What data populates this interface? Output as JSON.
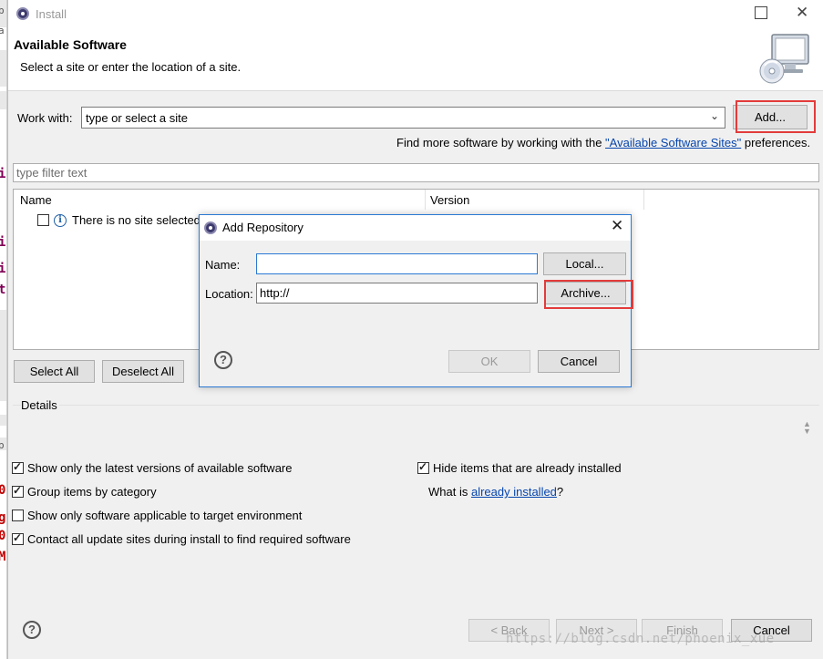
{
  "background_editor": {
    "fragments": [
      {
        "text": "b",
        "kind": "gray"
      },
      {
        "text": "a",
        "kind": "gray"
      },
      {
        "text": "i",
        "kind": "code"
      },
      {
        "text": "i",
        "kind": "code"
      },
      {
        "text": "i",
        "kind": "code"
      },
      {
        "text": "t",
        "kind": "code"
      },
      {
        "text": "p",
        "kind": "gray"
      },
      {
        "text": "0",
        "kind": "red"
      },
      {
        "text": "g",
        "kind": "red"
      },
      {
        "text": "0",
        "kind": "red"
      },
      {
        "text": "M",
        "kind": "red"
      }
    ]
  },
  "window": {
    "title": "Install",
    "minimize_icon": "maximize-icon",
    "close_glyph": "✕"
  },
  "banner": {
    "title": "Available Software",
    "subtitle": "Select a site or enter the location of a site."
  },
  "work_with": {
    "label": "Work with:",
    "value": "type or select a site",
    "add_button": "Add...",
    "more_text": "Find more software by working with the ",
    "more_link": "\"Available Software Sites\"",
    "more_suffix": " preferences."
  },
  "filter": {
    "placeholder": "type filter text"
  },
  "table": {
    "columns": [
      "Name",
      "Version"
    ],
    "rows": [
      {
        "checked": false,
        "icon": "info-icon",
        "name": "There is no site selected."
      }
    ]
  },
  "selection_buttons": {
    "select_all": "Select All",
    "deselect_all": "Deselect All"
  },
  "details": {
    "label": "Details"
  },
  "options": {
    "show_latest": {
      "label": "Show only the latest versions of available software",
      "checked": true
    },
    "group_by_category": {
      "label": "Group items by category",
      "checked": true
    },
    "show_applicable": {
      "label": "Show only software applicable to target environment",
      "checked": false
    },
    "contact_all_sites": {
      "label": "Contact all update sites during install to find required software",
      "checked": true
    },
    "hide_installed": {
      "label": "Hide items that are already installed",
      "checked": true
    },
    "what_is_prefix": "What is ",
    "what_is_link": "already installed",
    "what_is_suffix": "?"
  },
  "footer": {
    "help_glyph": "?",
    "back": "< Back",
    "next": "Next >",
    "finish": "Finish",
    "cancel": "Cancel"
  },
  "watermark": "https://blog.csdn.net/phoenix_xue",
  "dialog": {
    "title": "Add Repository",
    "name_label": "Name:",
    "name_value": "",
    "local_button": "Local...",
    "location_label": "Location:",
    "location_value": "http://",
    "archive_button": "Archive...",
    "help_glyph": "?",
    "ok_button": "OK",
    "cancel_button": "Cancel",
    "close_glyph": "✕"
  },
  "colors": {
    "highlight": "#e33b3b",
    "link": "#0645ad",
    "dialog_border": "#2b79d3",
    "window_bg": "#f0f0f0"
  }
}
